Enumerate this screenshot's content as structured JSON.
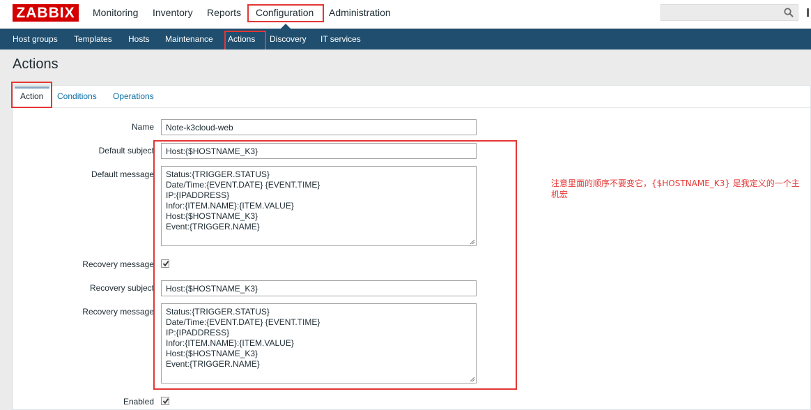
{
  "header": {
    "logo": "ZABBIX",
    "main_nav": [
      "Monitoring",
      "Inventory",
      "Reports",
      "Configuration",
      "Administration"
    ],
    "search_placeholder": ""
  },
  "sub_nav": [
    "Host groups",
    "Templates",
    "Hosts",
    "Maintenance",
    "Actions",
    "Discovery",
    "IT services"
  ],
  "page": {
    "title": "Actions"
  },
  "tabs": [
    "Action",
    "Conditions",
    "Operations"
  ],
  "form": {
    "name_label": "Name",
    "name_value": "Note-k3cloud-web",
    "default_subject_label": "Default subject",
    "default_subject_value": "Host:{$HOSTNAME_K3}",
    "default_message_label": "Default message",
    "default_message_lines": [
      "Status:{TRIGGER.STATUS}",
      "Date/Time:{EVENT.DATE} {EVENT.TIME}",
      "IP:{IPADDRESS}",
      "Infor:{ITEM.NAME}:{ITEM.VALUE}",
      "Host:{$HOSTNAME_K3}",
      "Event:{TRIGGER.NAME}"
    ],
    "recovery_message_label": "Recovery message",
    "recovery_message_checked": true,
    "recovery_subject_label": "Recovery subject",
    "recovery_subject_value": "Host:{$HOSTNAME_K3}",
    "recovery_text_label": "Recovery message",
    "recovery_message_lines": [
      "Status:{TRIGGER.STATUS}",
      "Date/Time:{EVENT.DATE} {EVENT.TIME}",
      "IP:{IPADDRESS}",
      "Infor:{ITEM.NAME}:{ITEM.VALUE}",
      "Host:{$HOSTNAME_K3}",
      "Event:{TRIGGER.NAME}"
    ],
    "enabled_label": "Enabled",
    "enabled_checked": true
  },
  "annotation": "注意里面的顺序不要变它，{$HOSTNAME_K3} 是我定义的一个主机宏",
  "colors": {
    "brand": "#d40000",
    "nav_bar": "#1f4e6e",
    "highlight_box": "#e33734",
    "link": "#0b6fa5"
  }
}
